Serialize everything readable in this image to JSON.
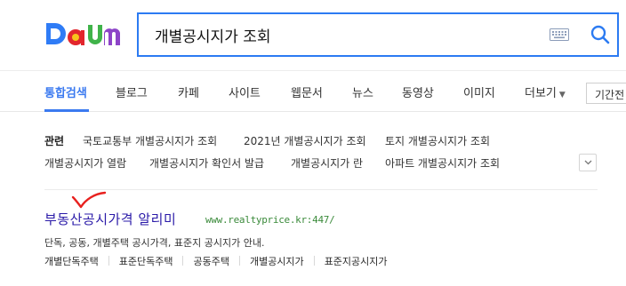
{
  "header": {
    "logo": {
      "name": "Daum",
      "colors": [
        "#2f7cf6",
        "#f7c31b",
        "#e2262d",
        "#40b34a",
        "#8d44c8"
      ]
    },
    "search": {
      "value": "개별공시지가 조회",
      "accent": "#2c7bf2"
    }
  },
  "tabs": [
    {
      "label": "통합검색",
      "active": true
    },
    {
      "label": "블로그"
    },
    {
      "label": "카페"
    },
    {
      "label": "사이트"
    },
    {
      "label": "웹문서"
    },
    {
      "label": "뉴스"
    },
    {
      "label": "동영상"
    },
    {
      "label": "이미지"
    }
  ],
  "more": {
    "label": "더보기"
  },
  "period": {
    "label": "기간전"
  },
  "related": {
    "label": "관련",
    "items": [
      "국토교통부 개별공시지가 조회",
      "2021년 개별공시지가 조회",
      "토지 개별공시지가 조회",
      "개별공시지가 열람",
      "개별공시지가 확인서 발급",
      "개별공시지가 란",
      "아파트 개별공시지가 조회"
    ]
  },
  "result": {
    "title": "부동산공시가격 알리미",
    "url": "www.realtyprice.kr:447/",
    "description": "단독, 공동, 개별주택 공시가격, 표준지 공시지가 안내.",
    "sublinks": [
      "개별단독주택",
      "표준단독주택",
      "공동주택",
      "개별공시지가",
      "표준지공시지가"
    ]
  }
}
